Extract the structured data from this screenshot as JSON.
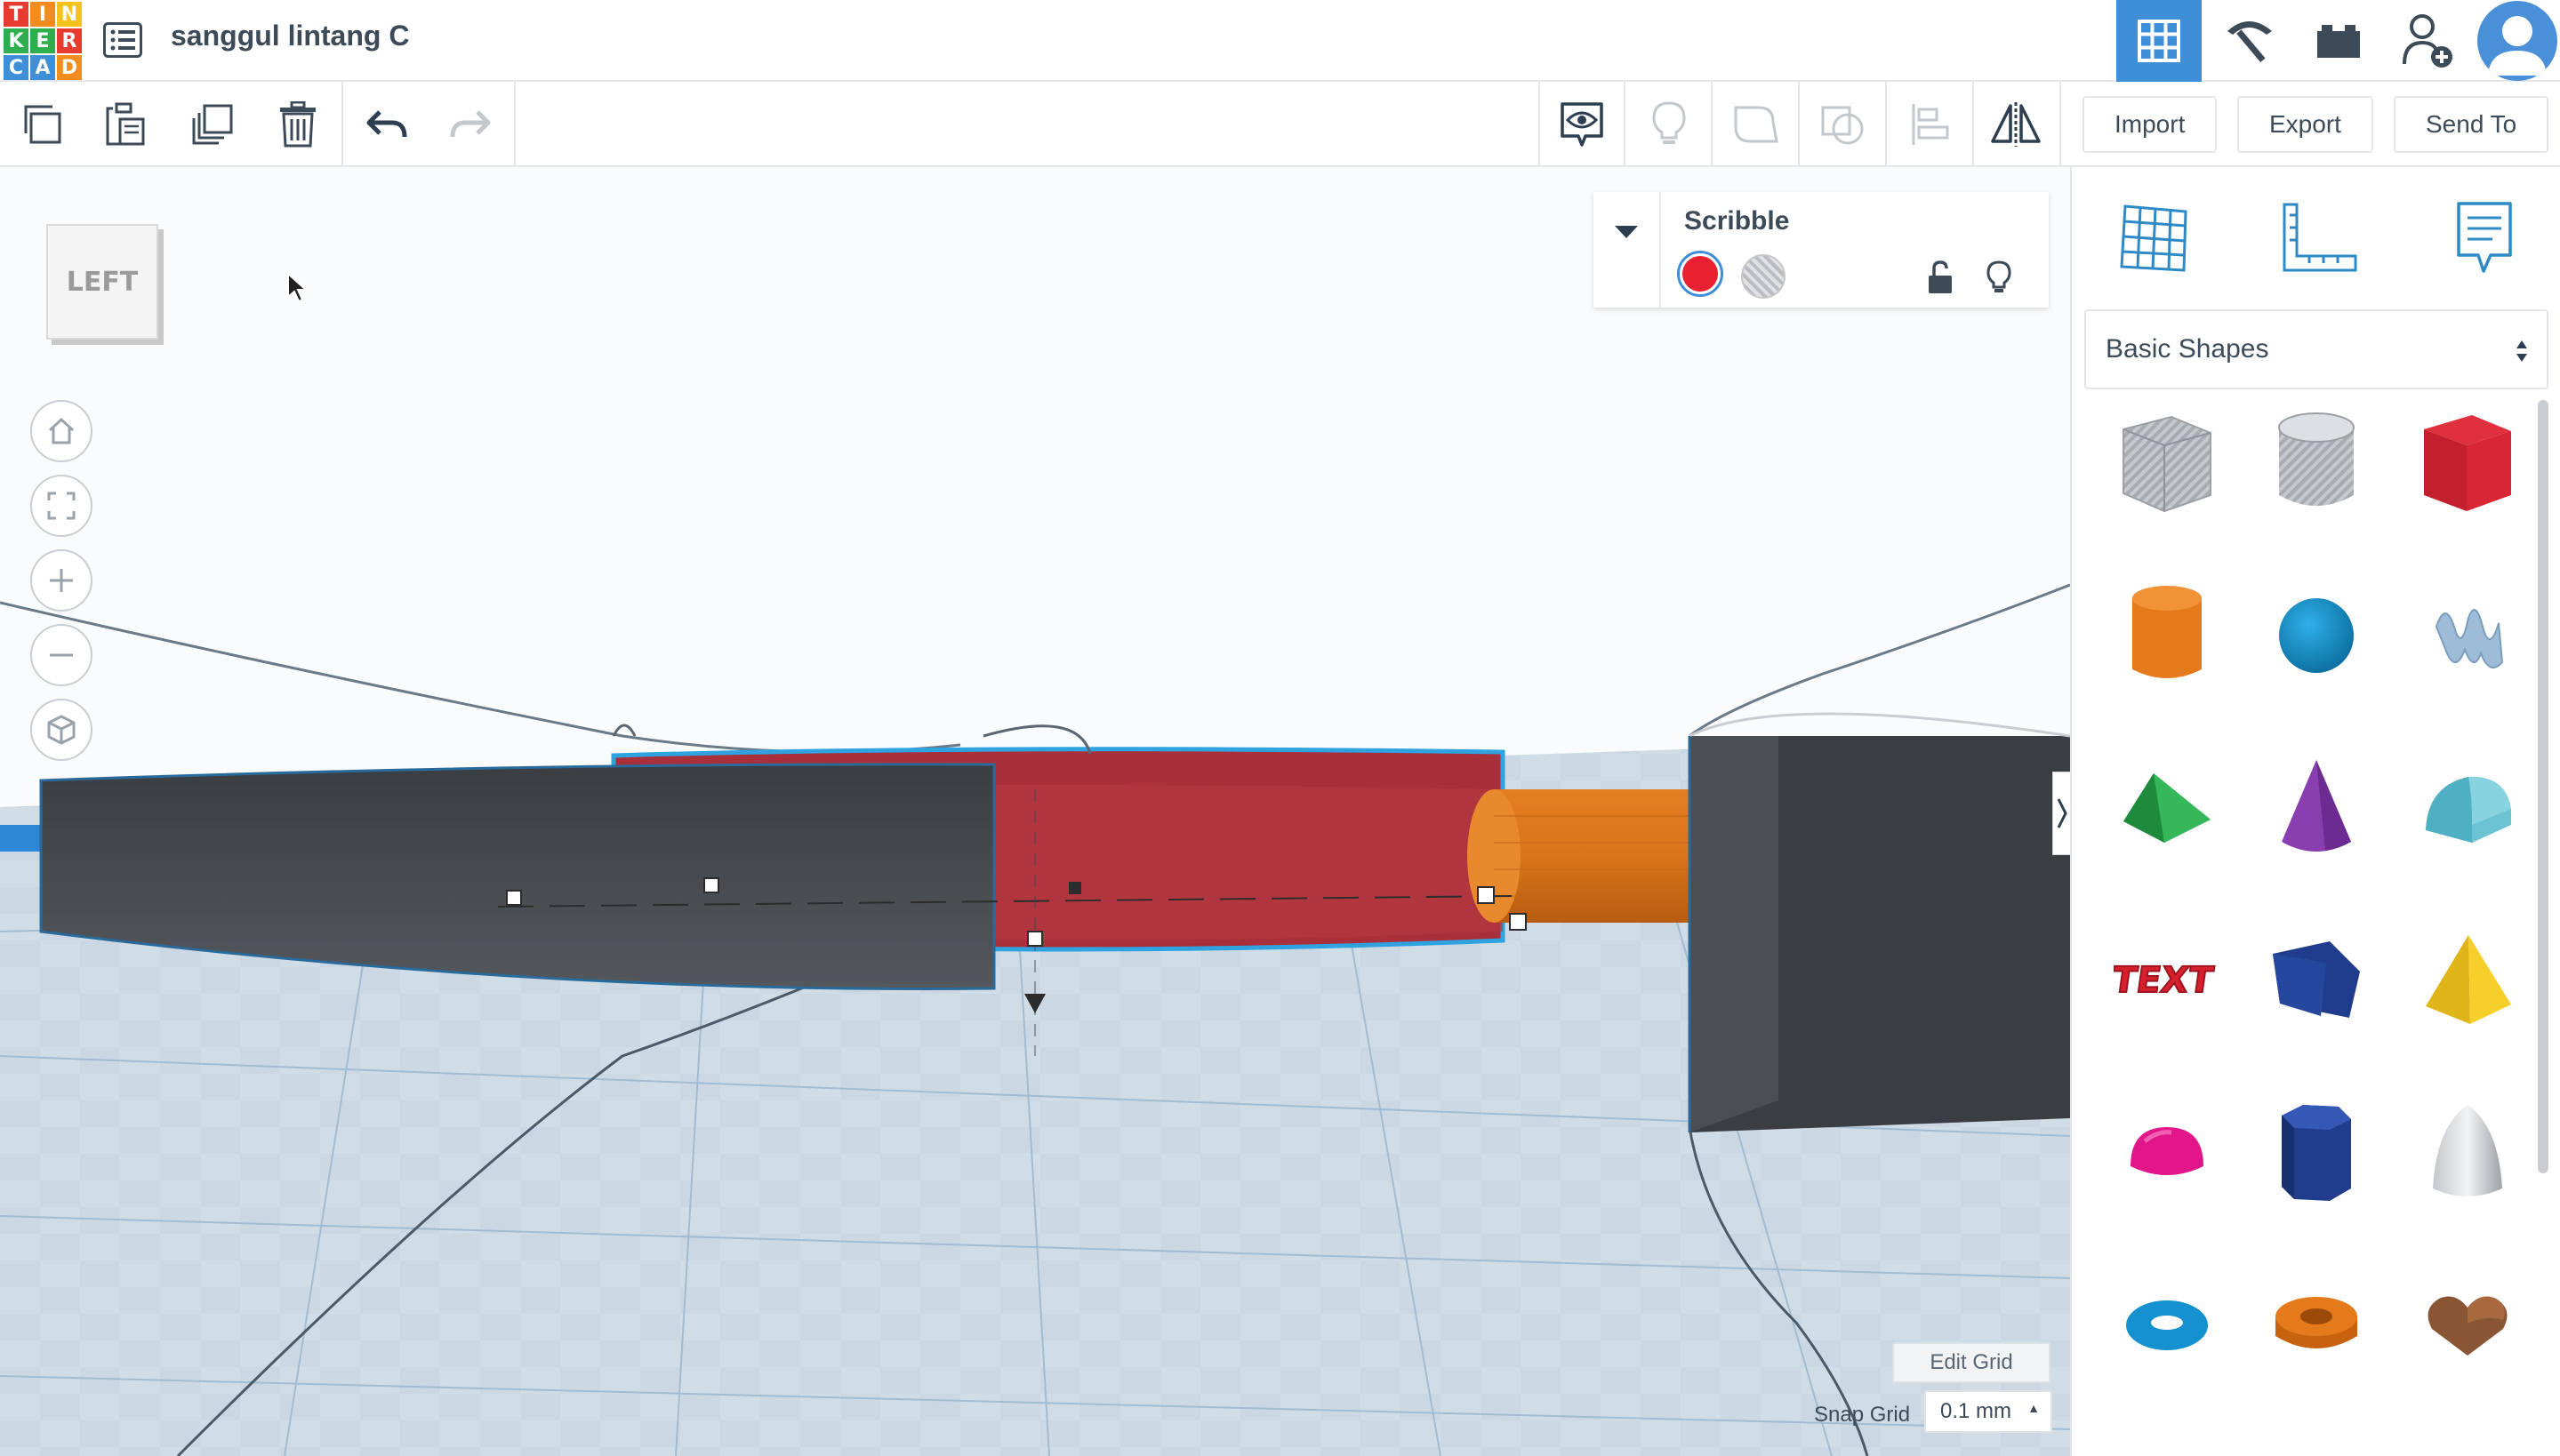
{
  "app": {
    "logo_letters": [
      "T",
      "I",
      "N",
      "K",
      "E",
      "R",
      "C",
      "A",
      "D"
    ],
    "logo_colors": [
      "#e63b2e",
      "#f28c1f",
      "#f7c21b",
      "#2eae4f",
      "#2eae4f",
      "#e63b2e",
      "#3f8ed8",
      "#3f8ed8",
      "#f28c1f"
    ],
    "design_title": "sanggul lintang C",
    "accent_color": "#3f8ed8"
  },
  "header": {
    "icons": [
      "3d-design-grid-icon",
      "codeblocks-pickaxe-icon",
      "bricks-icon",
      "invite-user-icon",
      "user-avatar"
    ]
  },
  "toolbar": {
    "left_tools": [
      "copy-icon",
      "paste-icon",
      "duplicate-icon",
      "delete-icon",
      "undo-icon",
      "redo-icon"
    ],
    "right_tools": [
      "show-hidden-icon",
      "light-bulb-icon",
      "group-icon",
      "ungroup-icon",
      "align-icon",
      "mirror-icon"
    ],
    "import_label": "Import",
    "export_label": "Export",
    "send_to_label": "Send To"
  },
  "workplane": {
    "view_cube_label": "LEFT",
    "nav_buttons": [
      "home-view-icon",
      "fit-view-icon",
      "zoom-in-icon",
      "zoom-out-icon",
      "perspective-icon"
    ],
    "edit_grid_label": "Edit Grid",
    "snap_grid_label": "Snap Grid",
    "snap_grid_value": "0.1 mm"
  },
  "inspector": {
    "shape_name": "Scribble",
    "solid_color": "#e8202f",
    "mode_selected": "solid"
  },
  "panel": {
    "top_buttons": [
      "workplane-grid-icon",
      "ruler-icon",
      "notes-icon"
    ],
    "category": "Basic Shapes",
    "shapes": [
      "box-hole",
      "cylinder-hole",
      "box",
      "cylinder",
      "sphere",
      "scribble",
      "roof",
      "cone",
      "round-roof",
      "text",
      "polygon-prism",
      "pyramid",
      "half-sphere",
      "hexagonal-prism",
      "paraboloid",
      "torus",
      "tube",
      "heart"
    ]
  },
  "shape_text_label": "TEXT"
}
